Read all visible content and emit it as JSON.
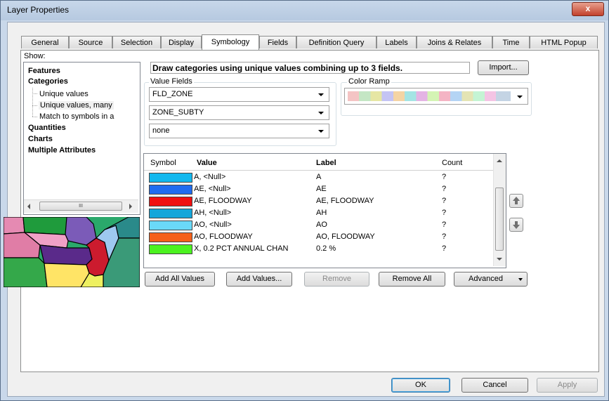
{
  "window": {
    "title": "Layer Properties",
    "close_label": "x"
  },
  "tabs": [
    {
      "label": "General"
    },
    {
      "label": "Source"
    },
    {
      "label": "Selection"
    },
    {
      "label": "Display"
    },
    {
      "label": "Symbology"
    },
    {
      "label": "Fields"
    },
    {
      "label": "Definition Query"
    },
    {
      "label": "Labels"
    },
    {
      "label": "Joins & Relates"
    },
    {
      "label": "Time"
    },
    {
      "label": "HTML Popup"
    }
  ],
  "active_tab": "Symbology",
  "show": {
    "label": "Show:",
    "items": [
      {
        "label": "Features"
      },
      {
        "label": "Categories"
      },
      {
        "label": "Unique values"
      },
      {
        "label": "Unique values, many"
      },
      {
        "label": "Match to symbols in a"
      },
      {
        "label": "Quantities"
      },
      {
        "label": "Charts"
      },
      {
        "label": "Multiple Attributes"
      }
    ],
    "scroll_thumb_label": "III"
  },
  "description": "Draw categories using unique values combining up to 3 fields.",
  "import_label": "Import...",
  "value_fields": {
    "label": "Value Fields",
    "fields": [
      "FLD_ZONE",
      "ZONE_SUBTY",
      "none"
    ]
  },
  "color_ramp": {
    "label": "Color Ramp"
  },
  "table": {
    "headers": {
      "symbol": "Symbol",
      "value": "Value",
      "label": "Label",
      "count": "Count"
    },
    "rows": [
      {
        "color": "#12b8ee",
        "value": "A, <Null>",
        "label": "A",
        "count": "?"
      },
      {
        "color": "#1f6cf0",
        "value": "AE, <Null>",
        "label": "AE",
        "count": "?"
      },
      {
        "color": "#f01010",
        "value": "AE, FLOODWAY",
        "label": "AE, FLOODWAY",
        "count": "?"
      },
      {
        "color": "#14a6da",
        "value": "AH, <Null>",
        "label": "AH",
        "count": "?"
      },
      {
        "color": "#6ad9f8",
        "value": "AO, <Null>",
        "label": "AO",
        "count": "?"
      },
      {
        "color": "#f5601a",
        "value": "AO, FLOODWAY",
        "label": "AO, FLOODWAY",
        "count": "?"
      },
      {
        "color": "#4cf220",
        "value": "X, 0.2 PCT ANNUAL CHAN",
        "label": "0.2 %",
        "count": "?"
      }
    ]
  },
  "buttons": {
    "add_all": "Add All Values",
    "add_values": "Add Values...",
    "remove": "Remove",
    "remove_all": "Remove All",
    "advanced": "Advanced",
    "ok": "OK",
    "cancel": "Cancel",
    "apply": "Apply"
  }
}
